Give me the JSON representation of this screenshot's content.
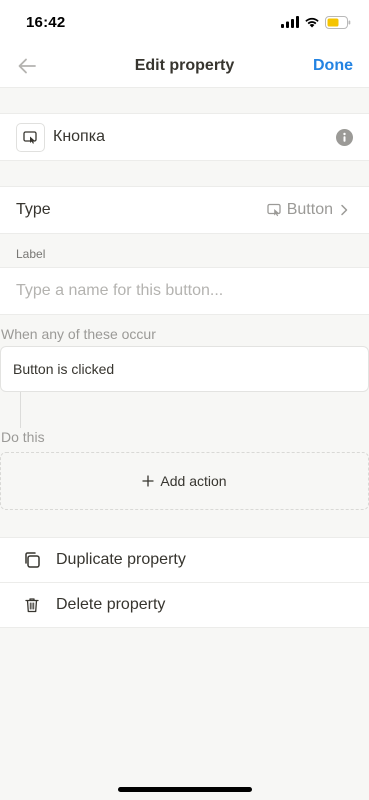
{
  "status_bar": {
    "time": "16:42"
  },
  "nav": {
    "title": "Edit property",
    "done_label": "Done"
  },
  "property": {
    "name": "Кнопка"
  },
  "type_row": {
    "label": "Type",
    "value": "Button"
  },
  "label_section": {
    "heading": "Label",
    "placeholder": "Type a name for this button..."
  },
  "automation": {
    "when_heading": "When any of these occur",
    "trigger": "Button is clicked",
    "do_heading": "Do this",
    "add_action_label": "Add action"
  },
  "actions": {
    "duplicate_label": "Duplicate property",
    "delete_label": "Delete property"
  },
  "colors": {
    "accent": "#2383e2",
    "background": "#f7f7f5",
    "battery": "#f5c400"
  }
}
